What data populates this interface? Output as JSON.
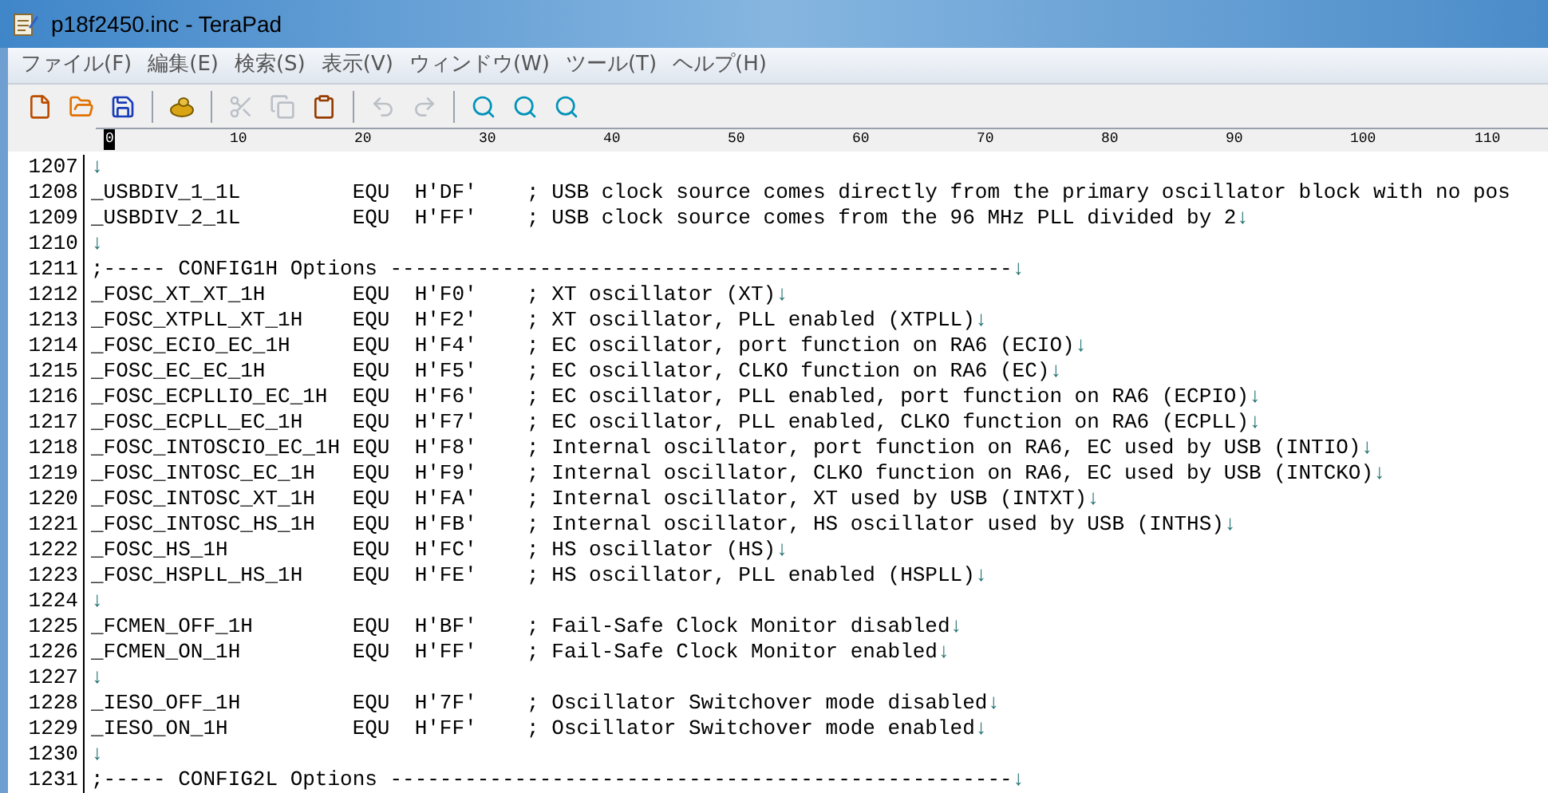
{
  "window": {
    "title": "p18f2450.inc - TeraPad"
  },
  "menu": [
    {
      "label": "ファイル(F)"
    },
    {
      "label": "編集(E)"
    },
    {
      "label": "検索(S)"
    },
    {
      "label": "表示(V)"
    },
    {
      "label": "ウィンドウ(W)"
    },
    {
      "label": "ツール(T)"
    },
    {
      "label": "ヘルプ(H)"
    }
  ],
  "toolbar": [
    {
      "kind": "new",
      "disabled": false
    },
    {
      "kind": "open",
      "disabled": false
    },
    {
      "kind": "save",
      "disabled": false
    },
    {
      "kind": "sep"
    },
    {
      "kind": "tool",
      "disabled": false
    },
    {
      "kind": "sep"
    },
    {
      "kind": "cut",
      "disabled": true
    },
    {
      "kind": "copy",
      "disabled": true
    },
    {
      "kind": "paste",
      "disabled": false
    },
    {
      "kind": "sep"
    },
    {
      "kind": "undo",
      "disabled": true
    },
    {
      "kind": "redo",
      "disabled": true
    },
    {
      "kind": "sep"
    },
    {
      "kind": "find",
      "disabled": false
    },
    {
      "kind": "find_prev",
      "disabled": false
    },
    {
      "kind": "find_next",
      "disabled": false
    }
  ],
  "ruler": [
    {
      "label": "0",
      "selected": true
    },
    {
      "label": "10",
      "selected": false
    },
    {
      "label": "20",
      "selected": false
    },
    {
      "label": "30",
      "selected": false
    },
    {
      "label": "40",
      "selected": false
    },
    {
      "label": "50",
      "selected": false
    },
    {
      "label": "60",
      "selected": false
    },
    {
      "label": "70",
      "selected": false
    },
    {
      "label": "80",
      "selected": false
    },
    {
      "label": "90",
      "selected": false
    },
    {
      "label": "100",
      "selected": false
    },
    {
      "label": "110",
      "selected": false
    }
  ],
  "lines": [
    {
      "number": "1207",
      "eol": "↓"
    },
    {
      "number": "1208",
      "text": "_USBDIV_1_1L         EQU  H'DF'    ; USB clock source comes directly from the primary oscillator block with no pos"
    },
    {
      "number": "1209",
      "text": "_USBDIV_2_1L         EQU  H'FF'    ; USB clock source comes from the 96 MHz PLL divided by 2",
      "eol": "↓"
    },
    {
      "number": "1210",
      "eol": "↓"
    },
    {
      "number": "1211",
      "text": ";----- CONFIG1H Options --------------------------------------------------",
      "eol": "↓"
    },
    {
      "number": "1212",
      "text": "_FOSC_XT_XT_1H       EQU  H'F0'    ; XT oscillator (XT)",
      "eol": "↓"
    },
    {
      "number": "1213",
      "text": "_FOSC_XTPLL_XT_1H    EQU  H'F2'    ; XT oscillator, PLL enabled (XTPLL)",
      "eol": "↓"
    },
    {
      "number": "1214",
      "text": "_FOSC_ECIO_EC_1H     EQU  H'F4'    ; EC oscillator, port function on RA6 (ECIO)",
      "eol": "↓"
    },
    {
      "number": "1215",
      "text": "_FOSC_EC_EC_1H       EQU  H'F5'    ; EC oscillator, CLKO function on RA6 (EC)",
      "eol": "↓"
    },
    {
      "number": "1216",
      "text": "_FOSC_ECPLLIO_EC_1H  EQU  H'F6'    ; EC oscillator, PLL enabled, port function on RA6 (ECPIO)",
      "eol": "↓"
    },
    {
      "number": "1217",
      "text": "_FOSC_ECPLL_EC_1H    EQU  H'F7'    ; EC oscillator, PLL enabled, CLKO function on RA6 (ECPLL)",
      "eol": "↓"
    },
    {
      "number": "1218",
      "text": "_FOSC_INTOSCIO_EC_1H EQU  H'F8'    ; Internal oscillator, port function on RA6, EC used by USB (INTIO)",
      "eol": "↓"
    },
    {
      "number": "1219",
      "text": "_FOSC_INTOSC_EC_1H   EQU  H'F9'    ; Internal oscillator, CLKO function on RA6, EC used by USB (INTCKO)",
      "eol": "↓"
    },
    {
      "number": "1220",
      "text": "_FOSC_INTOSC_XT_1H   EQU  H'FA'    ; Internal oscillator, XT used by USB (INTXT)",
      "eol": "↓"
    },
    {
      "number": "1221",
      "text": "_FOSC_INTOSC_HS_1H   EQU  H'FB'    ; Internal oscillator, HS oscillator used by USB (INTHS)",
      "eol": "↓"
    },
    {
      "number": "1222",
      "text": "_FOSC_HS_1H          EQU  H'FC'    ; HS oscillator (HS)",
      "eol": "↓"
    },
    {
      "number": "1223",
      "text": "_FOSC_HSPLL_HS_1H    EQU  H'FE'    ; HS oscillator, PLL enabled (HSPLL)",
      "eol": "↓"
    },
    {
      "number": "1224",
      "eol": "↓"
    },
    {
      "number": "1225",
      "text": "_FCMEN_OFF_1H        EQU  H'BF'    ; Fail-Safe Clock Monitor disabled",
      "eol": "↓"
    },
    {
      "number": "1226",
      "text": "_FCMEN_ON_1H         EQU  H'FF'    ; Fail-Safe Clock Monitor enabled",
      "eol": "↓"
    },
    {
      "number": "1227",
      "eol": "↓"
    },
    {
      "number": "1228",
      "text": "_IESO_OFF_1H         EQU  H'7F'    ; Oscillator Switchover mode disabled",
      "eol": "↓"
    },
    {
      "number": "1229",
      "text": "_IESO_ON_1H          EQU  H'FF'    ; Oscillator Switchover mode enabled",
      "eol": "↓"
    },
    {
      "number": "1230",
      "eol": "↓"
    },
    {
      "number": "1231",
      "text": ";----- CONFIG2L Options --------------------------------------------------",
      "eol": "↓"
    }
  ]
}
